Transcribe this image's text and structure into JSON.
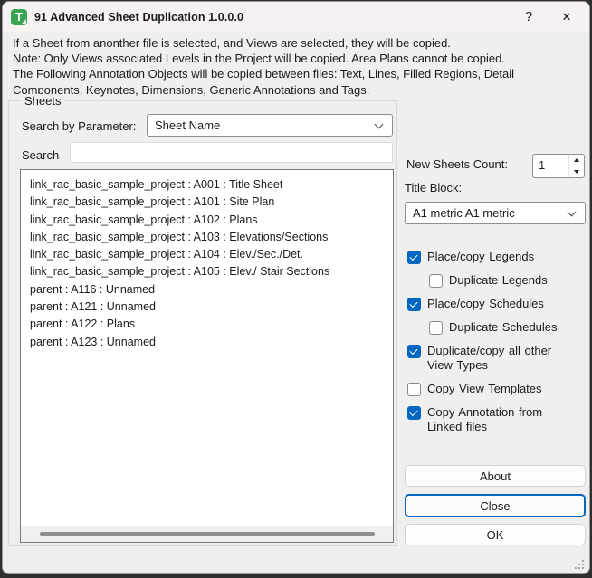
{
  "colors": {
    "accent": "#0067c0",
    "icon_green": "#3aa655",
    "titlebar_bg": "#f6f2f1",
    "dialog_bg": "#f0efed"
  },
  "window": {
    "title": "91 Advanced Sheet Duplication 1.0.0.0",
    "icon_letter": "T",
    "help_glyph": "?",
    "close_glyph": "✕"
  },
  "intro": {
    "lines": [
      "If a Sheet from anonther file is selected, and Views are selected, they will be copied.",
      "Note: Only Views associated Levels in the Project will be copied. Area Plans cannot be copied.",
      "The Following Annotation Objects will be copied between files: Text, Lines, Filled Regions, Detail Components, Keynotes, Dimensions, Generic Annotations and Tags."
    ]
  },
  "sheets": {
    "group_title": "Sheets",
    "search_by_label": "Search by Parameter:",
    "parameter_value": "Sheet Name",
    "search_label": "Search",
    "search_value": "",
    "items": [
      "link_rac_basic_sample_project : A001 : Title Sheet",
      "link_rac_basic_sample_project : A101 : Site Plan",
      "link_rac_basic_sample_project : A102 : Plans",
      "link_rac_basic_sample_project : A103 : Elevations/Sections",
      "link_rac_basic_sample_project : A104 : Elev./Sec./Det.",
      "link_rac_basic_sample_project : A105 : Elev./ Stair Sections",
      "parent : A116 : Unnamed",
      "parent : A121 : Unnamed",
      "parent : A122 : Plans",
      "parent : A123 : Unnamed"
    ]
  },
  "options": {
    "new_sheets_count_label": "New Sheets Count:",
    "new_sheets_count_value": "1",
    "title_block_label": "Title Block:",
    "title_block_value": "A1 metric A1 metric",
    "checkboxes": [
      {
        "label": "Place/copy Legends",
        "checked": true,
        "indent": false
      },
      {
        "label": "Duplicate Legends",
        "checked": false,
        "indent": true
      },
      {
        "label": "Place/copy Schedules",
        "checked": true,
        "indent": false
      },
      {
        "label": "Duplicate Schedules",
        "checked": false,
        "indent": true
      },
      {
        "label": "Duplicate/copy all other View Types",
        "checked": true,
        "indent": false
      },
      {
        "label": "Copy View Templates",
        "checked": false,
        "indent": false
      },
      {
        "label": "Copy Annotation from Linked files",
        "checked": true,
        "indent": false
      }
    ]
  },
  "buttons": {
    "about": "About",
    "close": "Close",
    "ok": "OK"
  }
}
